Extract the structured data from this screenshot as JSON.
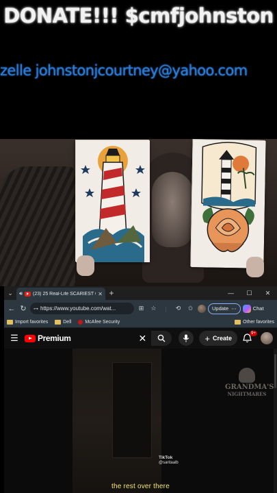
{
  "overlay": {
    "donate_text": "DONATE!!! $cmfjohnston",
    "zelle_text": "zelle johnstonjcourtney@yahoo.com"
  },
  "browser": {
    "tab": {
      "title": "(23) 25 Real-Life SCARIEST Gh",
      "close_icon": "close-icon"
    },
    "address": {
      "url": "https://www.youtube.com/wat..."
    },
    "update_label": "Update",
    "chat_label": "Chat",
    "favorites": [
      {
        "label": "Import favorites",
        "icon": "folder-icon"
      },
      {
        "label": "Dell",
        "icon": "folder-icon"
      },
      {
        "label": "McAfee Security",
        "icon": "mcafee-icon"
      }
    ],
    "other_favorites": "Other favorites"
  },
  "youtube": {
    "logo_text": "Premium",
    "create_label": "Create",
    "notification_count": "9+",
    "accent": "#ff0000"
  },
  "video": {
    "watermark_line1": "GRANDMA'S",
    "watermark_line2": "NIGHTMARES",
    "tiktok_label": "TikTok",
    "tiktok_handle": "@saritaalb",
    "subtitle": "the rest over there"
  },
  "colors": {
    "zelle_blue": "#2b7bd6",
    "subtitle_yellow": "#f5e96a",
    "update_border": "#8ab4f8"
  }
}
